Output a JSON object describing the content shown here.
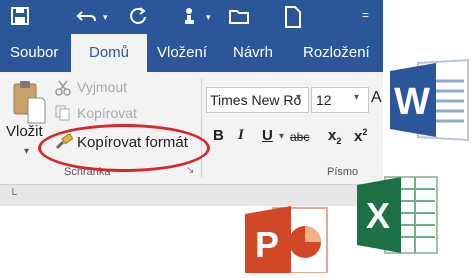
{
  "tabs": [
    "Soubor",
    "Domů",
    "Vložení",
    "Návrh",
    "Rozložení"
  ],
  "clipboard": {
    "paste_label": "Vložit",
    "cut_label": "Vyjmout",
    "copy_label": "Kopírovat",
    "format_painter_label": "Kopírovat formát",
    "group_label": "Schránka"
  },
  "font": {
    "font_name": "Times New Ro",
    "font_size": "12",
    "group_label": "Písmo",
    "bold": "B",
    "italic": "I",
    "underline": "U",
    "strike": "abc",
    "subscript": "x",
    "sub_mark": "2",
    "superscript": "x",
    "sup_mark": "2",
    "extra": "A"
  },
  "logos": {
    "word_letter": "W",
    "excel_letter": "X",
    "powerpoint_letter": "P"
  },
  "colors": {
    "word_blue": "#2b579a",
    "highlight_red": "#d9262b",
    "excel_green": "#1e7145",
    "powerpoint_orange": "#d24726"
  }
}
